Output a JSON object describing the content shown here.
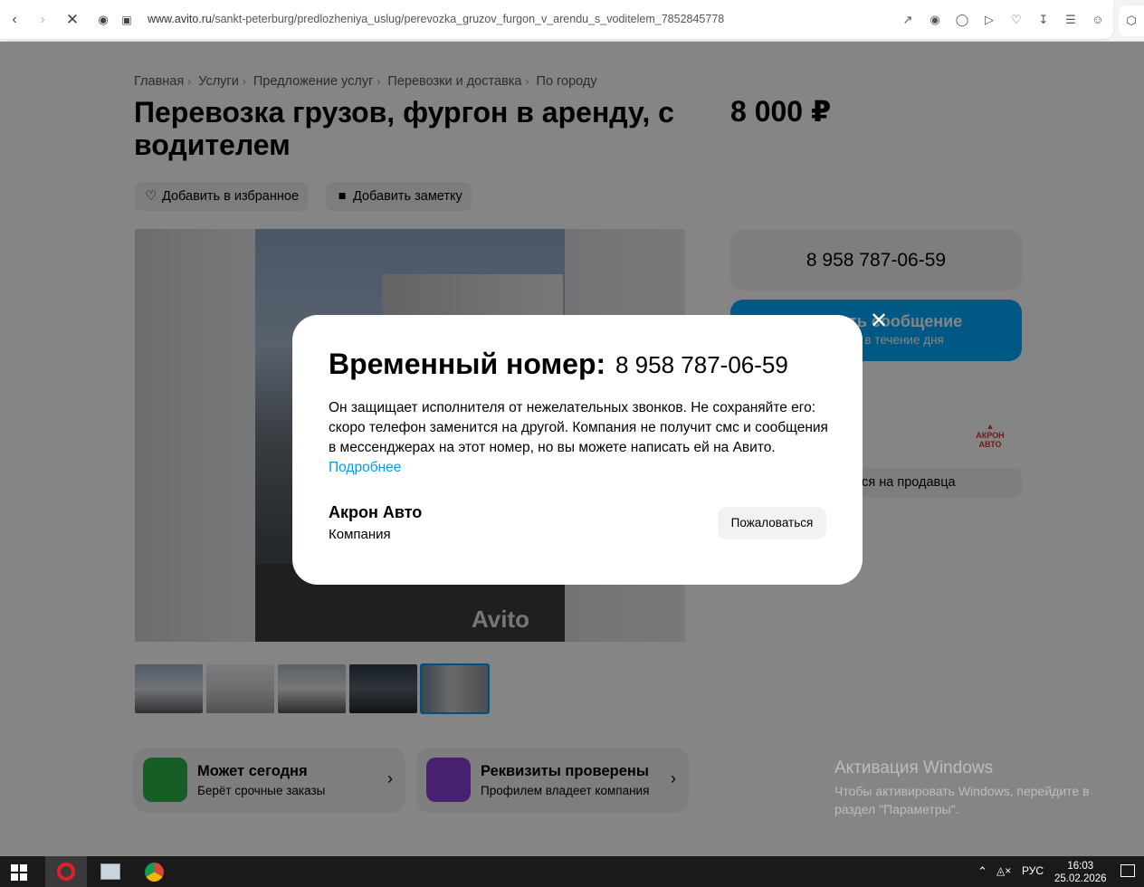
{
  "browser": {
    "url_domain": "www.avito.ru",
    "url_path": "/sankt-peterburg/predlozheniya_uslug/perevozka_gruzov_furgon_v_arendu_s_voditelem_7852845778"
  },
  "breadcrumb": [
    "Главная",
    "Услуги",
    "Предложение услуг",
    "Перевозки и доставка",
    "По городу"
  ],
  "listing": {
    "title": "Перевозка грузов, фургон в аренду, с водителем",
    "price": "8 000 ₽",
    "favorite_label": "Добавить в избранное",
    "note_label": "Добавить заметку",
    "watermark": "Avito"
  },
  "sidebar": {
    "phone": "8 958 787-06-59",
    "message_label": "Написать сообщение",
    "message_sub": "Отвечает в течение дня",
    "subscribe_label": "Подписаться на продавца",
    "logo_text": "АКРОН АВТО"
  },
  "features": [
    {
      "title": "Может сегодня",
      "subtitle": "Берёт срочные заказы",
      "color": "#2bb34a"
    },
    {
      "title": "Реквизиты проверены",
      "subtitle": "Профилем владеет компания",
      "color": "#8a3fd6"
    }
  ],
  "modal": {
    "title": "Временный номер:",
    "phone": "8 958 787-06-59",
    "text": "Он защищает исполнителя от нежелательных звонков. Не сохраняйте его: скоро телефон заменится на другой. Компания не получит смс и сообщения в мессенджерах на этот номер, но вы можете написать ей на Авито.",
    "more_link": "Подробнее",
    "company": "Акрон Авто",
    "company_type": "Компания",
    "report_label": "Пожаловаться"
  },
  "windows": {
    "activate_title": "Активация Windows",
    "activate_text": "Чтобы активировать Windows, перейдите в раздел \"Параметры\".",
    "lang": "РУС",
    "time": "16:03",
    "date": "25.02.2026"
  },
  "colors": {
    "accent": "#00aaff",
    "link": "#0099f7"
  }
}
